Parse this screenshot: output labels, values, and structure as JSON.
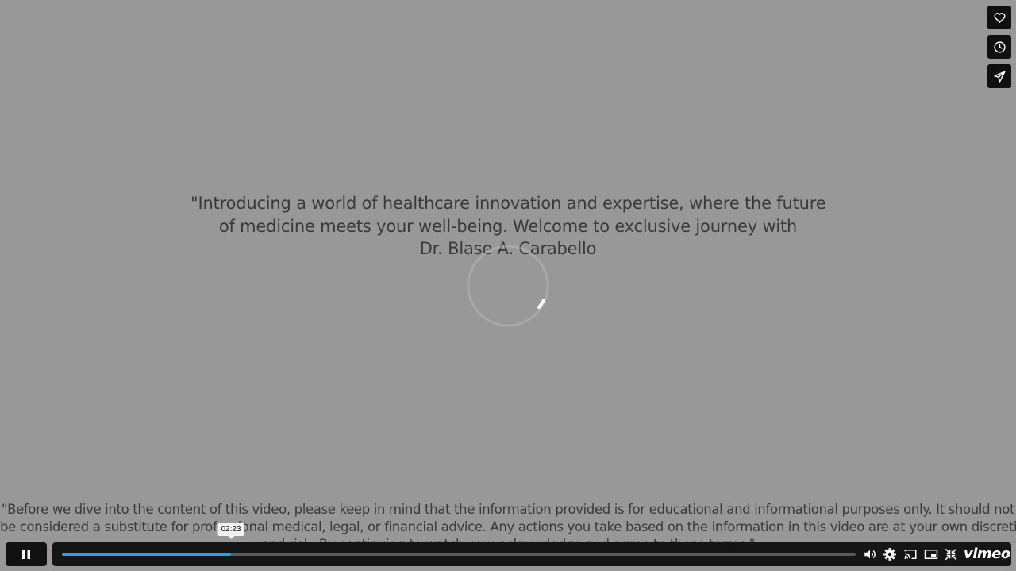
{
  "video": {
    "intro_lines": [
      "\"Introducing a world of healthcare innovation and expertise, where the future",
      "of medicine meets your well-being. Welcome to exclusive journey with",
      "Dr. Blase A. Carabello"
    ],
    "disclaimer_lines": [
      "\"Before we dive into the content of this video, please keep in mind that the information provided is for educational and informational purposes only. It should not",
      "be considered a substitute for professional medical, legal, or financial advice. Any actions you take based on the information in this video are at your own discretion",
      "and risk. By continuing to watch, you acknowledge and agree to these terms.\""
    ]
  },
  "side_actions": {
    "like_icon": "heart-icon",
    "watch_later_icon": "clock-icon",
    "share_icon": "send-icon"
  },
  "controls": {
    "play_state_icon": "pause-icon",
    "progress_fraction": 0.213,
    "current_time_tooltip": "02:23",
    "brand": "vimeo",
    "accent_color": "#17a9e4",
    "icons": [
      "volume-icon",
      "gear-icon",
      "cast-icon",
      "pip-icon",
      "exit-fullscreen-icon"
    ]
  }
}
